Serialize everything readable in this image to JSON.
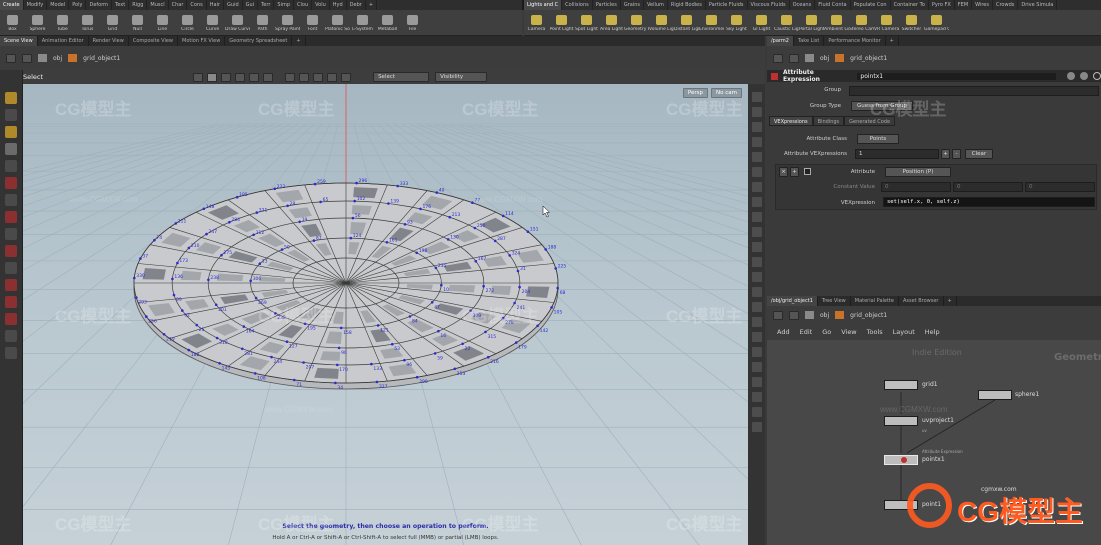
{
  "shelf_tabs_left": [
    "Create",
    "Modify",
    "Model",
    "Poly",
    "Deform",
    "Text",
    "Rigg",
    "Muscl",
    "Char",
    "Cons",
    "Hair",
    "Guid",
    "Gui",
    "Terr",
    "Simp",
    "Clou",
    "Volu",
    "Hyd",
    "Debr",
    "+"
  ],
  "shelf_tabs_right": [
    "Lights and C",
    "Collisions",
    "Particles",
    "Grains",
    "Vellum",
    "Rigid Bodies",
    "Particle Fluids",
    "Viscous Fluids",
    "Oceans",
    "Fluid Conta",
    "Populate Con",
    "Container To",
    "Pyro FX",
    "FEM",
    "Wires",
    "Crowds",
    "Drive Simula"
  ],
  "tools_left": [
    "Box",
    "Sphere",
    "Tube",
    "Torus",
    "Grid",
    "Null",
    "Line",
    "Circle",
    "Curve",
    "Draw Curve",
    "Path",
    "Spray Paint",
    "Font",
    "Platonic Solids",
    "L-System",
    "Metaball",
    "File"
  ],
  "tools_right": [
    "Camera",
    "Point Light",
    "Spot Light",
    "Area Light",
    "Geometry Light",
    "Volume Light",
    "Distant Light",
    "Environment Light",
    "Sky Light",
    "GI Light",
    "Caustic Light",
    "Portal Light",
    "Ambient Light",
    "Stereo Camera",
    "VR Camera",
    "Switcher",
    "Gamepad Camera"
  ],
  "pane_tabs_left": [
    "Scene View",
    "Animation Editor",
    "Render View",
    "Composite View",
    "Motion FX View",
    "Geometry Spreadsheet",
    "+"
  ],
  "pane_tabs_right": [
    "/parm2",
    "Take List",
    "Performance Monitor",
    "+"
  ],
  "viewport": {
    "path_obj": "obj",
    "path_node": "grid_object1",
    "select_label": "Select",
    "select_dropdown": "Select",
    "visibility_dropdown": "Visibility",
    "persp_label": "Persp",
    "cam_label": "No cam",
    "status_line1": "Select the geometry, then choose an operation to perform.",
    "status_line2": "Hold A or Ctrl-A or Shift-A or Ctrl-Shift-A to select full (MMB) or partial (LMB) loops."
  },
  "parm": {
    "node_type": "Attribute Expression",
    "node_name": "pointx1",
    "group_label": "Group",
    "group_type_label": "Group Type",
    "group_type_value": "Guess from Group",
    "tabs": [
      "VEXpressions",
      "Bindings",
      "Generated Code"
    ],
    "attribute_class_label": "Attribute Class",
    "attribute_class_value": "Points",
    "attribute_vexpressions_label": "Attribute VEXpressions",
    "attribute_vexpressions_value": "1",
    "clear_button": "Clear",
    "attribute_label": "Attribute",
    "attribute_value": "Position (P)",
    "constant_value_label": "Constant Value",
    "constant_values": [
      "0",
      "0",
      "0"
    ],
    "vexpression_label": "VEXpression",
    "vexpression_value": "set(self.x, 0, self.z)"
  },
  "network": {
    "tabs": [
      "/obj/grid_object1",
      "Tree View",
      "Material Palette",
      "Asset Browser",
      "+"
    ],
    "path_obj": "obj",
    "path_node": "grid_object1",
    "menu": [
      "Add",
      "Edit",
      "Go",
      "View",
      "Tools",
      "Layout",
      "Help"
    ],
    "edition_label": "Indie Edition",
    "context_label": "Geometry",
    "nodes": [
      {
        "name": "grid1",
        "sub": ""
      },
      {
        "name": "sphere1",
        "sub": ""
      },
      {
        "name": "uvproject1",
        "sub": "uv"
      },
      {
        "name": "pointx1",
        "sub": "Attribute Expression"
      },
      {
        "name": "point1",
        "sub": ""
      }
    ]
  },
  "watermark": {
    "brand": "CG模型主",
    "url": "www.CGMXW.com",
    "url_alt": "cgmxw.com"
  },
  "colors": {
    "viewport_top": "#a6b7c2",
    "viewport_bottom": "#c6d1d7",
    "point_label": "#2b2bd0",
    "wire": "#3a3a3a",
    "y_axis": "#e05050",
    "parm_header": "#2a2a2a",
    "node_body": "#bdbdbd",
    "logo_orange": "#ff5a1f"
  }
}
